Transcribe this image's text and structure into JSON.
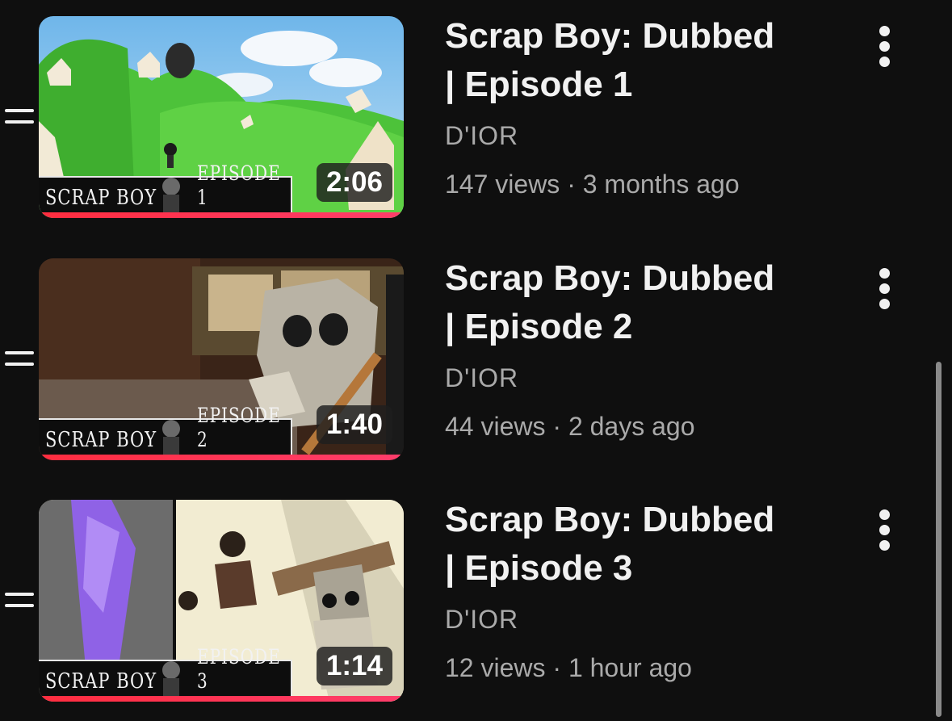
{
  "playlist": {
    "items": [
      {
        "title_line1": "Scrap Boy: Dubbed",
        "title_line2": "| Episode 1",
        "channel": "D'IOR",
        "views": "147 views",
        "age": "3 months ago",
        "separator": "·",
        "duration": "2:06",
        "thumb_title": "SCRAP BOY",
        "thumb_episode": "EPISODE 1",
        "watched_fraction": 1.0
      },
      {
        "title_line1": "Scrap Boy: Dubbed",
        "title_line2": "| Episode 2",
        "channel": "D'IOR",
        "views": "44 views",
        "age": "2 days ago",
        "separator": "·",
        "duration": "1:40",
        "thumb_title": "SCRAP BOY",
        "thumb_episode": "EPISODE 2",
        "watched_fraction": 1.0
      },
      {
        "title_line1": "Scrap Boy: Dubbed",
        "title_line2": "| Episode 3",
        "channel": "D'IOR",
        "views": "12 views",
        "age": "1 hour ago",
        "separator": "·",
        "duration": "1:14",
        "thumb_title": "SCRAP BOY",
        "thumb_episode": "EPISODE 3",
        "watched_fraction": 1.0
      }
    ]
  },
  "icons": {
    "drag": "drag-handle-icon",
    "more": "more-vertical-icon"
  },
  "colors": {
    "background": "#0f0f0f",
    "progress": "#ff2d3f",
    "title": "#f1f1f1",
    "secondary_text": "#aaaaaa"
  }
}
